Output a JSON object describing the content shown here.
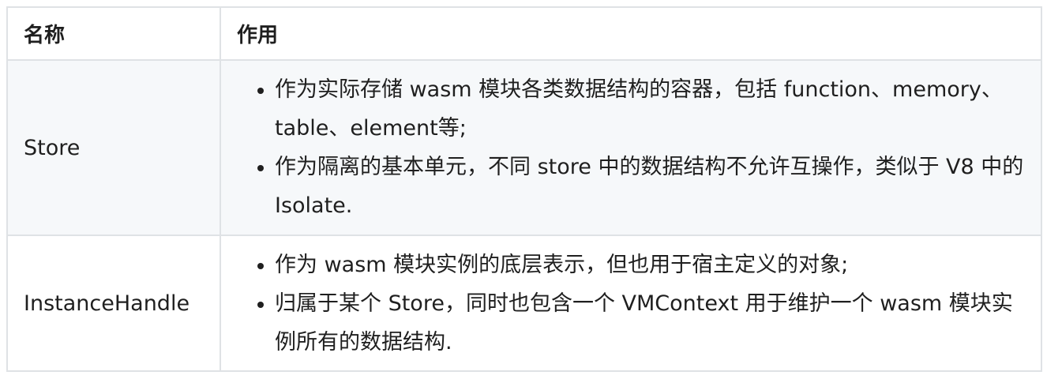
{
  "table": {
    "headers": [
      "名称",
      "作用"
    ],
    "rows": [
      {
        "name": "Store",
        "items": [
          "作为实际存储 wasm 模块各类数据结构的容器，包括 function、memory、table、element等;",
          "作为隔离的基本单元，不同 store 中的数据结构不允许互操作，类似于 V8 中的 Isolate."
        ]
      },
      {
        "name": "InstanceHandle",
        "items": [
          "作为 wasm 模块实例的底层表示，但也用于宿主定义的对象;",
          "归属于某个 Store，同时也包含一个 VMContext 用于维护一个 wasm 模块实例所有的数据结构."
        ]
      }
    ]
  }
}
